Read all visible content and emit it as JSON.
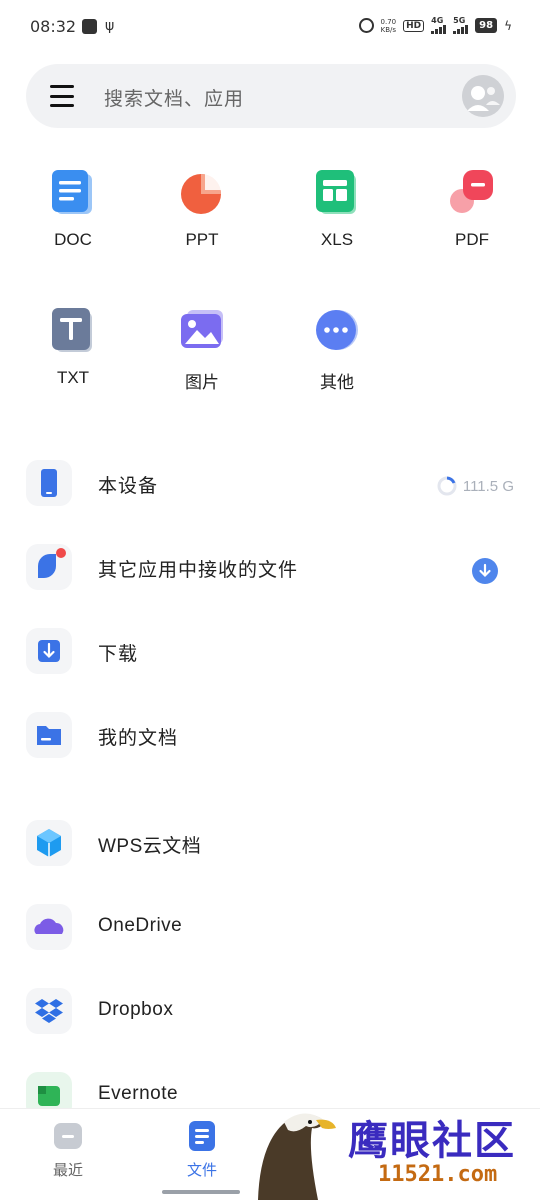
{
  "status_bar": {
    "time": "08:32",
    "speed_top": "0.70",
    "speed_bottom": "KB/s",
    "hd": "HD",
    "sig1_label": "4G",
    "sig2_label": "5G",
    "battery": "98"
  },
  "search": {
    "placeholder": "搜索文档、应用"
  },
  "file_types": [
    {
      "label": "DOC",
      "icon": "doc-icon",
      "color": "#3a8ef0"
    },
    {
      "label": "PPT",
      "icon": "ppt-icon",
      "color": "#f0603f"
    },
    {
      "label": "XLS",
      "icon": "xls-icon",
      "color": "#1fbf7a"
    },
    {
      "label": "PDF",
      "icon": "pdf-icon",
      "color": "#f0465a"
    },
    {
      "label": "TXT",
      "icon": "txt-icon",
      "color": "#6b7b9a"
    },
    {
      "label": "图片",
      "icon": "image-icon",
      "color": "#7b6cf0"
    },
    {
      "label": "其他",
      "icon": "more-icon",
      "color": "#5b7ef2"
    }
  ],
  "locations": [
    {
      "label": "本设备",
      "icon": "phone-icon",
      "storage": "111.5 G"
    },
    {
      "label": "其它应用中接收的文件",
      "icon": "received-icon"
    },
    {
      "label": "下载",
      "icon": "download-icon"
    },
    {
      "label": "我的文档",
      "icon": "folder-icon"
    }
  ],
  "cloud": [
    {
      "label": "WPS云文档",
      "icon": "wps-cloud-icon"
    },
    {
      "label": "OneDrive",
      "icon": "onedrive-icon"
    },
    {
      "label": "Dropbox",
      "icon": "dropbox-icon"
    },
    {
      "label": "Evernote",
      "icon": "evernote-icon"
    }
  ],
  "bottom_nav": [
    {
      "label": "最近",
      "icon": "recent-icon",
      "active": false
    },
    {
      "label": "文件",
      "icon": "files-icon",
      "active": true
    }
  ],
  "watermark": {
    "title": "鹰眼社区",
    "url": "11521.com"
  },
  "colors": {
    "accent": "#3b73e6",
    "badge_red": "#f04a4a"
  }
}
